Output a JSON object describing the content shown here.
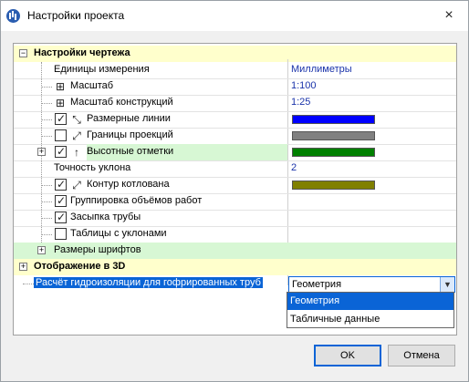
{
  "window": {
    "title": "Настройки проекта",
    "close_icon": "×"
  },
  "sections": {
    "drawing": "Настройки чертежа",
    "display3d": "Отображение в 3D"
  },
  "rows": {
    "units_label": "Единицы измерения",
    "units_value": "Миллиметры",
    "scale_label": "Масштаб",
    "scale_value": "1:100",
    "construct_scale_label": "Масштаб конструкций",
    "construct_scale_value": "1:25",
    "dim_lines_label": "Размерные линии",
    "dim_lines_color": "#0000ff",
    "proj_bounds_label": "Границы проекций",
    "proj_bounds_color": "#808080",
    "height_marks_label": "Высотные отметки",
    "height_marks_color": "#008000",
    "slope_precision_label": "Точность уклона",
    "slope_precision_value": "2",
    "pit_contour_label": "Контур котлована",
    "pit_contour_color": "#808000",
    "group_volumes_label": "Группировка объёмов работ",
    "pipe_backfill_label": "Засыпка трубы",
    "slope_tables_label": "Таблицы с уклонами",
    "font_sizes_label": "Размеры шрифтов",
    "waterproof_label": "Расчёт гидроизоляции для гофрированных труб",
    "waterproof_value": "Геометрия"
  },
  "checkboxes": {
    "dim_lines": true,
    "proj_bounds": false,
    "height_marks": true,
    "pit_contour": true,
    "group_volumes": true,
    "pipe_backfill": true,
    "slope_tables": false
  },
  "dropdown": {
    "options": [
      "Геометрия",
      "Табличные данные"
    ],
    "selected": "Геометрия"
  },
  "buttons": {
    "ok": "OK",
    "cancel": "Отмена"
  },
  "colors": {
    "selection": "#0a64d6",
    "section_bg": "#ffffcc",
    "highlight_bg": "#d7f7d4"
  }
}
